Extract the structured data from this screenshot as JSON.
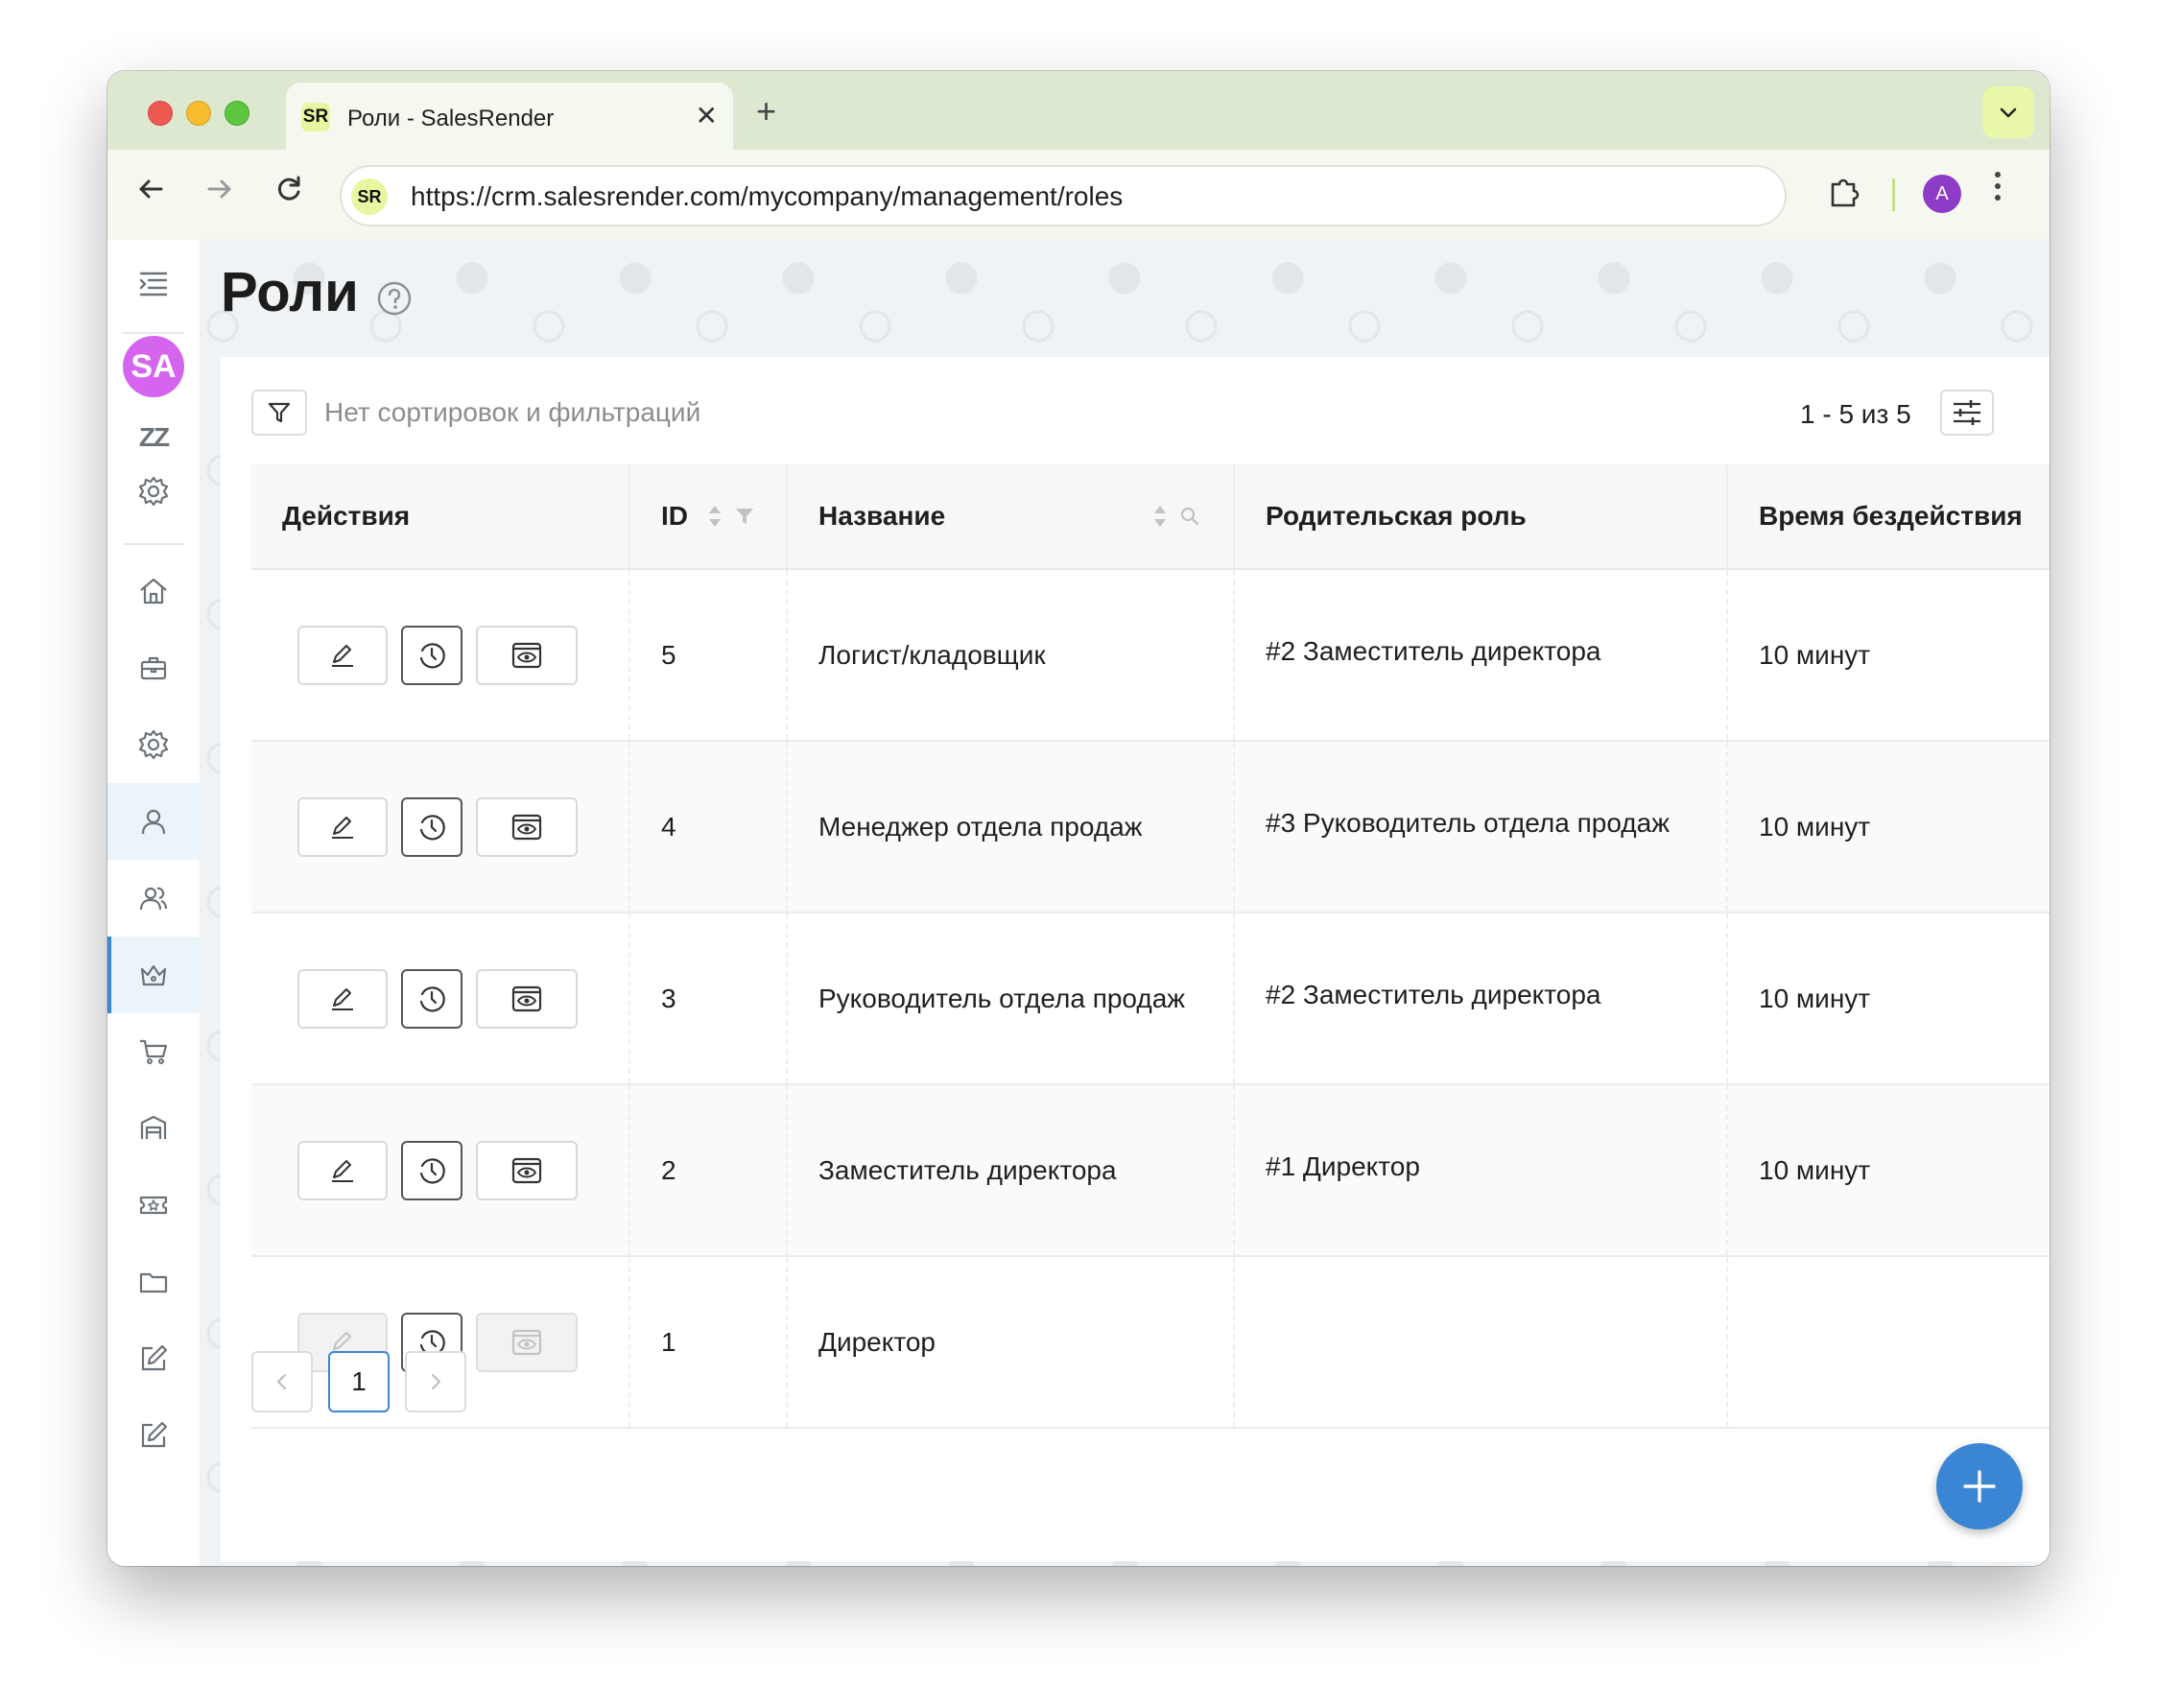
{
  "browser": {
    "tab_title": "Роли - SalesRender",
    "tab_favicon": "SR",
    "tab_close": "✕",
    "new_tab": "+",
    "tabs_dropdown": "⌄",
    "url": "https://crm.salesrender.com/mycompany/management/roles",
    "omnibox_favicon": "SR",
    "profile_initial": "A",
    "back": "←",
    "forward": "→",
    "reload": "↻",
    "menu": "⋮"
  },
  "sidebar": {
    "avatar_initials": "SA",
    "sleep_label": "ZZ",
    "items": [
      {
        "icon": "menu-collapse-icon"
      },
      {
        "icon": "settings-icon"
      },
      {
        "icon": "home-icon"
      },
      {
        "icon": "briefcase-icon"
      },
      {
        "icon": "gear-icon"
      },
      {
        "icon": "user-icon"
      },
      {
        "icon": "users-icon"
      },
      {
        "icon": "crown-icon",
        "active": true
      },
      {
        "icon": "cart-icon"
      },
      {
        "icon": "warehouse-icon"
      },
      {
        "icon": "ticket-icon"
      },
      {
        "icon": "folder-icon"
      },
      {
        "icon": "edit-icon"
      },
      {
        "icon": "edit-icon"
      }
    ]
  },
  "page": {
    "title": "Роли"
  },
  "toolbar": {
    "filter_text": "Нет сортировок и фильтраций",
    "range_text": "1 - 5 из 5"
  },
  "table": {
    "headers": {
      "actions": "Действия",
      "id": "ID",
      "name": "Название",
      "parent": "Родительская роль",
      "idle": "Время бездействия"
    },
    "rows": [
      {
        "id": "5",
        "name": "Логист/кладовщик",
        "parent": "#2 Заместитель директора",
        "idle": "10 минут",
        "disabled": false
      },
      {
        "id": "4",
        "name": "Менеджер отдела продаж",
        "parent": "#3 Руководитель отдела продаж",
        "idle": "10 минут",
        "disabled": false
      },
      {
        "id": "3",
        "name": "Руководитель отдела продаж",
        "parent": "#2 Заместитель директора",
        "idle": "10 минут",
        "disabled": false
      },
      {
        "id": "2",
        "name": "Заместитель директора",
        "parent": "#1 Директор",
        "idle": "10 минут",
        "disabled": false
      },
      {
        "id": "1",
        "name": "Директор",
        "parent": "",
        "idle": "",
        "disabled": true
      }
    ]
  },
  "pagination": {
    "prev": "<",
    "current": "1",
    "next": ">"
  },
  "colors": {
    "accent": "#3a85d4",
    "avatar": "#d565ef",
    "tabstrip": "#dde8d1"
  }
}
